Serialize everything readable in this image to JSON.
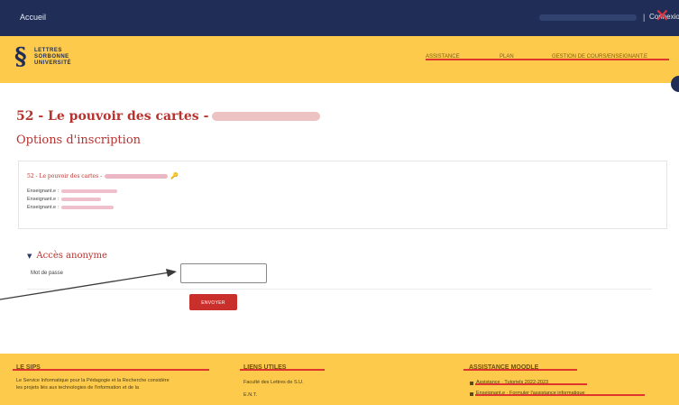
{
  "topbar": {
    "home_label": "Accueil",
    "separator": "|",
    "login_label": "Connexion"
  },
  "header": {
    "logo_text": "LETTRES\nSORBONNE\nUNIVERSITÉ",
    "nav": [
      "ASSISTANCE",
      "PLAN",
      "GESTION DE COURS/ENSEIGNANT.E"
    ]
  },
  "course": {
    "title": "52 - Le pouvoir des cartes -",
    "subtitle": "Options d'inscription",
    "card_title": "52 - Le pouvoir des cartes -",
    "teachers": [
      "Enseignant.e :",
      "Enseignant.e :",
      "Enseignant.e :"
    ]
  },
  "enrol": {
    "section_title": "Accès anonyme",
    "password_label": "Mot de passe",
    "password_value": "",
    "submit_label": "ENVOYER"
  },
  "footer": {
    "col1_heading": "LE SIPS",
    "col1_text": [
      "Le Service Informatique pour la Pédagogie et la Recherche considère",
      "les projets liés aux technologies de l'information et de la"
    ],
    "col2_heading": "LIENS UTILES",
    "col2_text": [
      "Faculté des Lettres de S.U.",
      "E.N.T."
    ],
    "col3_heading": "ASSISTANCE MOODLE",
    "col3_links": [
      "Assistance · Tutoriels 2022-2023",
      "Enseignant.e · Formuler l'assistance informatique"
    ]
  },
  "colors": {
    "navy": "#1f2d57",
    "yellow": "#fdca4c",
    "red": "#b8322e",
    "button_red": "#c9302c",
    "strike_red": "#e0352e"
  },
  "icons": [
    "close-icon",
    "key-icon",
    "triangle-down-icon",
    "arrow-annotation"
  ]
}
